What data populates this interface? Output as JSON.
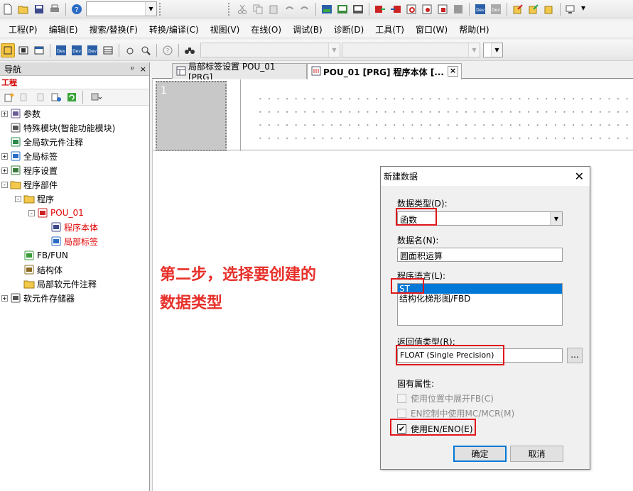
{
  "menu": [
    "工程(P)",
    "编辑(E)",
    "搜索/替换(F)",
    "转换/编译(C)",
    "视图(V)",
    "在线(O)",
    "调试(B)",
    "诊断(D)",
    "工具(T)",
    "窗口(W)",
    "帮助(H)"
  ],
  "navigation": {
    "title": "导航",
    "pin": "ᵖ",
    "close": "×",
    "section": "工程",
    "tree": [
      {
        "label": "参数",
        "level": 0,
        "exp": "+",
        "icon": "parameter-icon"
      },
      {
        "label": "特殊模块(智能功能模块)",
        "level": 0,
        "exp": "",
        "icon": "module-icon"
      },
      {
        "label": "全局软元件注释",
        "level": 0,
        "exp": "",
        "icon": "comment-icon"
      },
      {
        "label": "全局标签",
        "level": 0,
        "exp": "+",
        "icon": "label-icon"
      },
      {
        "label": "程序设置",
        "level": 0,
        "exp": "+",
        "icon": "program-setting-icon"
      },
      {
        "label": "程序部件",
        "level": 0,
        "exp": "-",
        "icon": "folder-icon"
      },
      {
        "label": "程序",
        "level": 1,
        "exp": "-",
        "icon": "folder-icon"
      },
      {
        "label": "POU_01",
        "level": 2,
        "exp": "-",
        "icon": "pou-icon",
        "red": true
      },
      {
        "label": "程序本体",
        "level": 3,
        "exp": "",
        "icon": "program-body-icon",
        "red": true
      },
      {
        "label": "局部标签",
        "level": 3,
        "exp": "",
        "icon": "local-label-icon",
        "red": true
      },
      {
        "label": "FB/FUN",
        "level": 1,
        "exp": "",
        "icon": "fb-icon"
      },
      {
        "label": "结构体",
        "level": 1,
        "exp": "",
        "icon": "struct-icon"
      },
      {
        "label": "局部软元件注释",
        "level": 1,
        "exp": "",
        "icon": "folder-icon"
      },
      {
        "label": "软元件存储器",
        "level": 0,
        "exp": "+",
        "icon": "memory-icon"
      }
    ]
  },
  "tabs": [
    {
      "label": "局部标签设置 POU_01 [PRG]",
      "active": false
    },
    {
      "label": "POU_01 [PRG] 程序本体 [...",
      "active": true
    }
  ],
  "tab_close": "×",
  "editor": {
    "line_number": "1"
  },
  "annotation": {
    "line1": "第二步，选择要创建的",
    "line2": "数据类型"
  },
  "dialog": {
    "title": "新建数据",
    "close": "✕",
    "data_type_label": "数据类型(D):",
    "data_type_value": "函数",
    "data_name_label": "数据名(N):",
    "data_name_value": "圆面积运算",
    "language_label": "程序语言(L):",
    "languages": [
      "ST",
      "结构化梯形图/FBD"
    ],
    "return_type_label": "返回值类型(R):",
    "return_type_value": "FLOAT (Single Precision)",
    "browse": "...",
    "props_label": "固有属性:",
    "opt_expand_fb": "使用位置中展开FB(C)",
    "opt_en_mc": "EN控制中使用MC/MCR(M)",
    "opt_en_eno": "使用EN/ENO(E)",
    "check_mark": "✔",
    "ok": "确定",
    "cancel": "取消"
  }
}
